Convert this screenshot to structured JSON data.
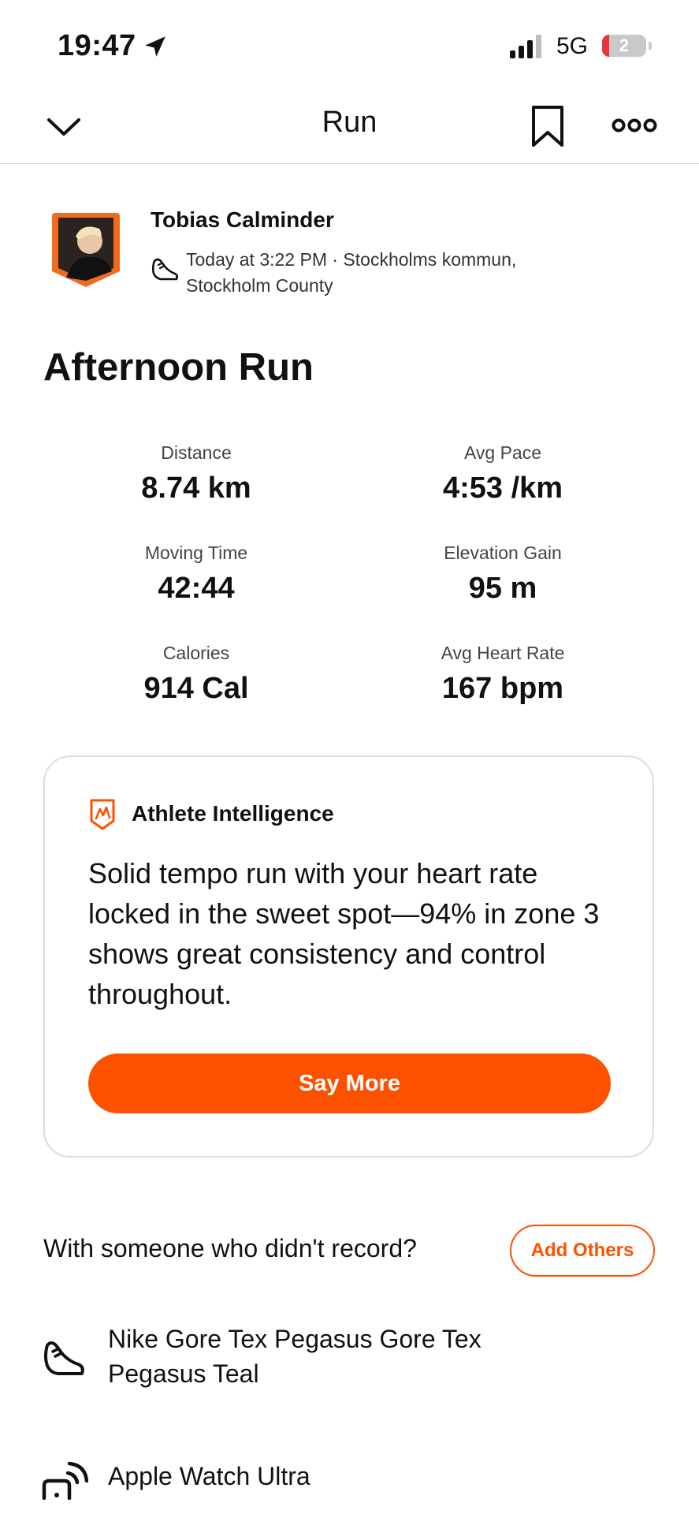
{
  "status_bar": {
    "time": "19:47",
    "network": "5G",
    "battery": "2"
  },
  "nav": {
    "title": "Run"
  },
  "athlete": {
    "name": "Tobias Calminder",
    "meta": "Today at 3:22 PM · Stockholms kommun, Stockholm County"
  },
  "activity": {
    "title": "Afternoon Run"
  },
  "stats": [
    {
      "label": "Distance",
      "value": "8.74 km"
    },
    {
      "label": "Avg Pace",
      "value": "4:53 /km"
    },
    {
      "label": "Moving Time",
      "value": "42:44"
    },
    {
      "label": "Elevation Gain",
      "value": "95 m"
    },
    {
      "label": "Calories",
      "value": "914 Cal"
    },
    {
      "label": "Avg Heart Rate",
      "value": "167 bpm"
    }
  ],
  "ai_card": {
    "heading": "Athlete Intelligence",
    "body": "Solid tempo run with your heart rate locked in the sweet spot—94% in zone 3 shows great consistency and control throughout.",
    "button": "Say More"
  },
  "companions": {
    "prompt": "With someone who didn't record?",
    "button": "Add Others"
  },
  "gear": {
    "shoes": "Nike Gore Tex Pegasus Gore Tex Pegasus Teal",
    "device": "Apple Watch Ultra"
  },
  "colors": {
    "accent": "#fc5200",
    "text": "#111111",
    "divider": "#d8d8d8",
    "card_border": "#dddddd"
  }
}
